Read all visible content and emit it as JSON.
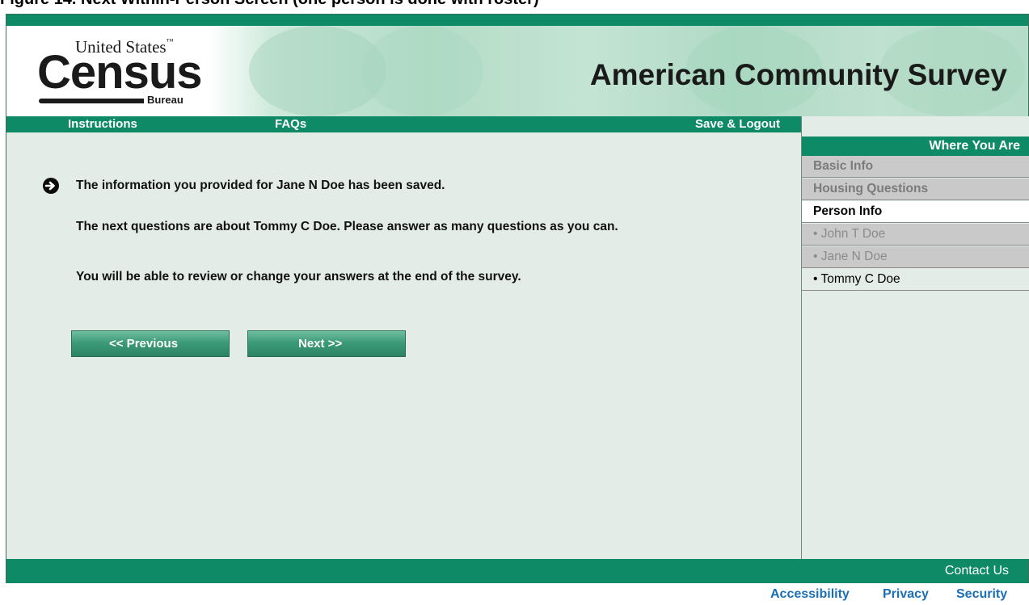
{
  "caption": "Figure 14. Next Within-Person Screen (one person is done with roster)",
  "header": {
    "logo": {
      "line1": "United States",
      "tm": "™",
      "main": "Census",
      "sub": "Bureau"
    },
    "title": "American Community Survey"
  },
  "nav": {
    "instructions": "Instructions",
    "faqs": "FAQs",
    "save_logout": "Save & Logout"
  },
  "content": {
    "saved_message": "The information you provided for Jane N Doe has been saved.",
    "next_message": "The next questions are about Tommy C Doe. Please answer as many questions as you can.",
    "review_message": "You will be able to review or change your answers at the end of the survey.",
    "prev_button": "<< Previous",
    "next_button": "Next >>"
  },
  "sidebar": {
    "heading": "Where You Are",
    "items": [
      {
        "label": "Basic Info",
        "state": "grey"
      },
      {
        "label": "Housing Questions",
        "state": "grey"
      },
      {
        "label": "Person Info",
        "state": "active"
      },
      {
        "label": "• John T Doe",
        "state": "sub"
      },
      {
        "label": "• Jane N Doe",
        "state": "sub"
      },
      {
        "label": "• Tommy C Doe",
        "state": "current"
      }
    ]
  },
  "footer": {
    "contact": "Contact Us",
    "links": [
      "Accessibility",
      "Privacy",
      "Security"
    ]
  },
  "colors": {
    "brand_green": "#0f8a67",
    "link_blue": "#1b6fb5"
  }
}
